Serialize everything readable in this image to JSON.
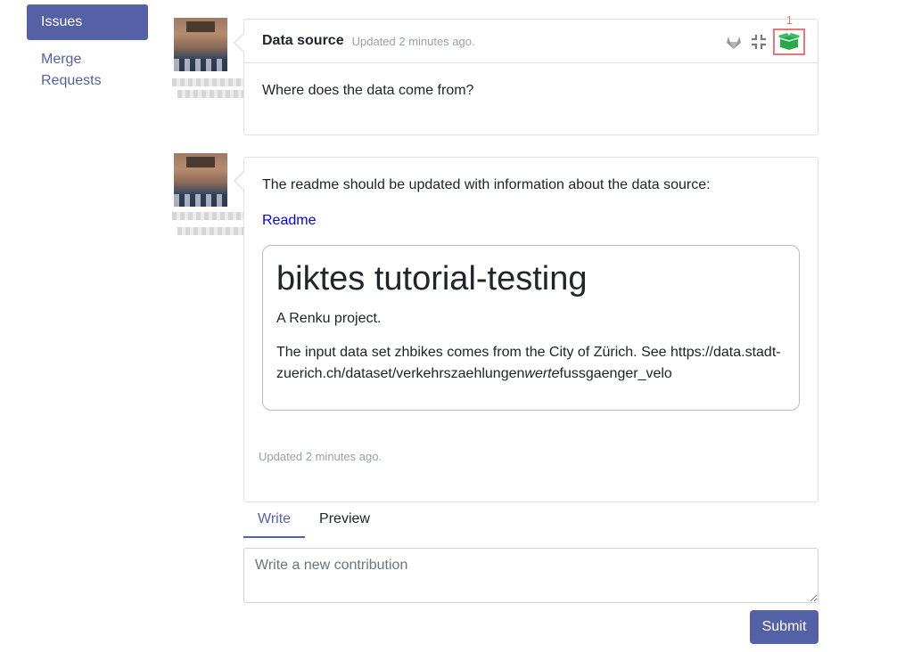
{
  "sidebar": {
    "items": [
      {
        "label": "Issues"
      },
      {
        "label": "Merge Requests"
      }
    ]
  },
  "issue": {
    "title": "Data source",
    "updated": "Updated 2 minutes ago.",
    "body": "Where does the data come from?",
    "marker": "1",
    "icons": [
      "gitlab-icon",
      "collapse-icon",
      "open-box-icon"
    ],
    "accent_color": "#5561a6",
    "highlight_color": "#ea7676",
    "box_icon_color": "#2aa84a"
  },
  "contribution": {
    "text": "The readme should be updated with information about the data source:",
    "link_label": "Readme",
    "readme": {
      "heading": "biktes tutorial-testing",
      "subtitle": "A Renku project.",
      "paragraph_before": "The input data set zhbikes comes from the City of Zürich. See https://data.stadt-zuerich.ch/dataset/verkehrszaehlungen",
      "paragraph_em": "werte",
      "paragraph_after": "fussgaenger_velo"
    },
    "updated": "Updated 2 minutes ago."
  },
  "tabs": [
    {
      "label": "Write"
    },
    {
      "label": "Preview"
    }
  ],
  "new_contribution": {
    "placeholder": "Write a new contribution"
  },
  "submit_label": "Submit"
}
